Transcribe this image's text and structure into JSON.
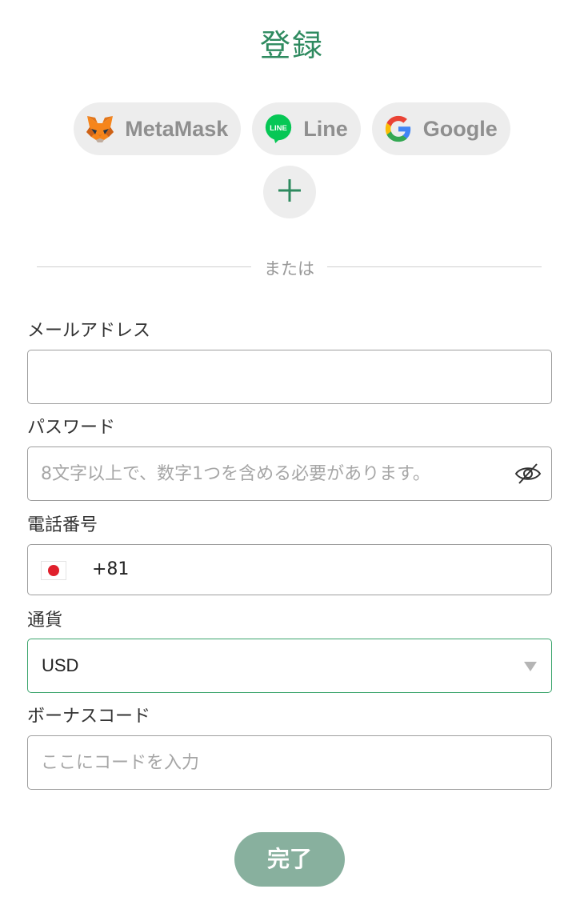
{
  "header": {
    "title": "登録"
  },
  "social": {
    "metamask_label": "MetaMask",
    "line_label": "Line",
    "google_label": "Google",
    "more_symbol": "+"
  },
  "divider": {
    "text": "または"
  },
  "form": {
    "email": {
      "label": "メールアドレス",
      "value": "",
      "placeholder": ""
    },
    "password": {
      "label": "パスワード",
      "value": "",
      "placeholder": "8文字以上で、数字1つを含める必要があります。"
    },
    "phone": {
      "label": "電話番号",
      "country_code": "+81",
      "value": ""
    },
    "currency": {
      "label": "通貨",
      "selected": "USD"
    },
    "bonus": {
      "label": "ボーナスコード",
      "value": "",
      "placeholder": "ここにコードを入力"
    }
  },
  "submit": {
    "label": "完了"
  },
  "colors": {
    "accent": "#2e8a5f",
    "submit_bg": "#88b09e",
    "select_border": "#3ca56d"
  },
  "icons": [
    "metamask-fox-icon",
    "line-icon",
    "google-icon",
    "plus-icon",
    "eye-off-icon",
    "japan-flag-icon",
    "caret-down-icon"
  ]
}
